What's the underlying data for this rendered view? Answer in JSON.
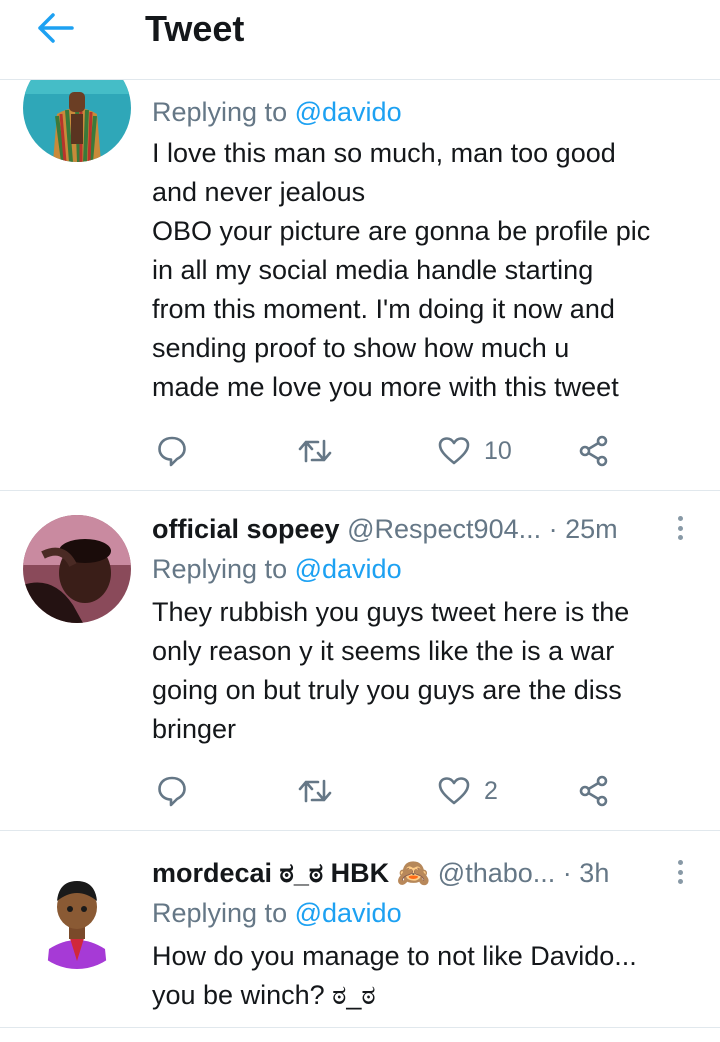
{
  "header": {
    "title": "Tweet"
  },
  "tweets": [
    {
      "name": "",
      "handle": "",
      "time": "",
      "replying_prefix": "Replying to",
      "replying_to": "@davido",
      "text_lines": [
        "I love this man so much, man too good",
        "and never jealous",
        "OBO your picture are gonna be profile pic",
        "in all my social media handle starting",
        "from this moment. I'm doing it now and",
        "sending proof to show how much u",
        "made me love you more with this tweet"
      ],
      "like_count": "10"
    },
    {
      "name": "official sopeey",
      "handle": "@Respect904...",
      "separator": "·",
      "time": "25m",
      "replying_prefix": "Replying to",
      "replying_to": "@davido",
      "text_lines": [
        "They rubbish you guys tweet here is the",
        "only reason y it seems like the is a war",
        "going on but truly you guys are the diss",
        "bringer"
      ],
      "like_count": "2"
    },
    {
      "name": "mordecai ಠ_ಠ HBK 🙈",
      "handle": "@thabo...",
      "separator": "·",
      "time": "3h",
      "replying_prefix": "Replying to",
      "replying_to": "@davido",
      "text_lines": [
        "How do you manage to not like Davido...",
        "you be winch? ಠ_ಠ"
      ]
    }
  ],
  "icons": {
    "back": "arrow-left-icon",
    "reply": "reply-bubble-icon",
    "retweet": "retweet-icon",
    "like": "heart-icon",
    "share": "share-icon",
    "more": "more-vertical-icon"
  },
  "colors": {
    "accent": "#1da1f2",
    "secondary_text": "#657786",
    "icon": "#657786",
    "divider": "#e1e8ed"
  }
}
